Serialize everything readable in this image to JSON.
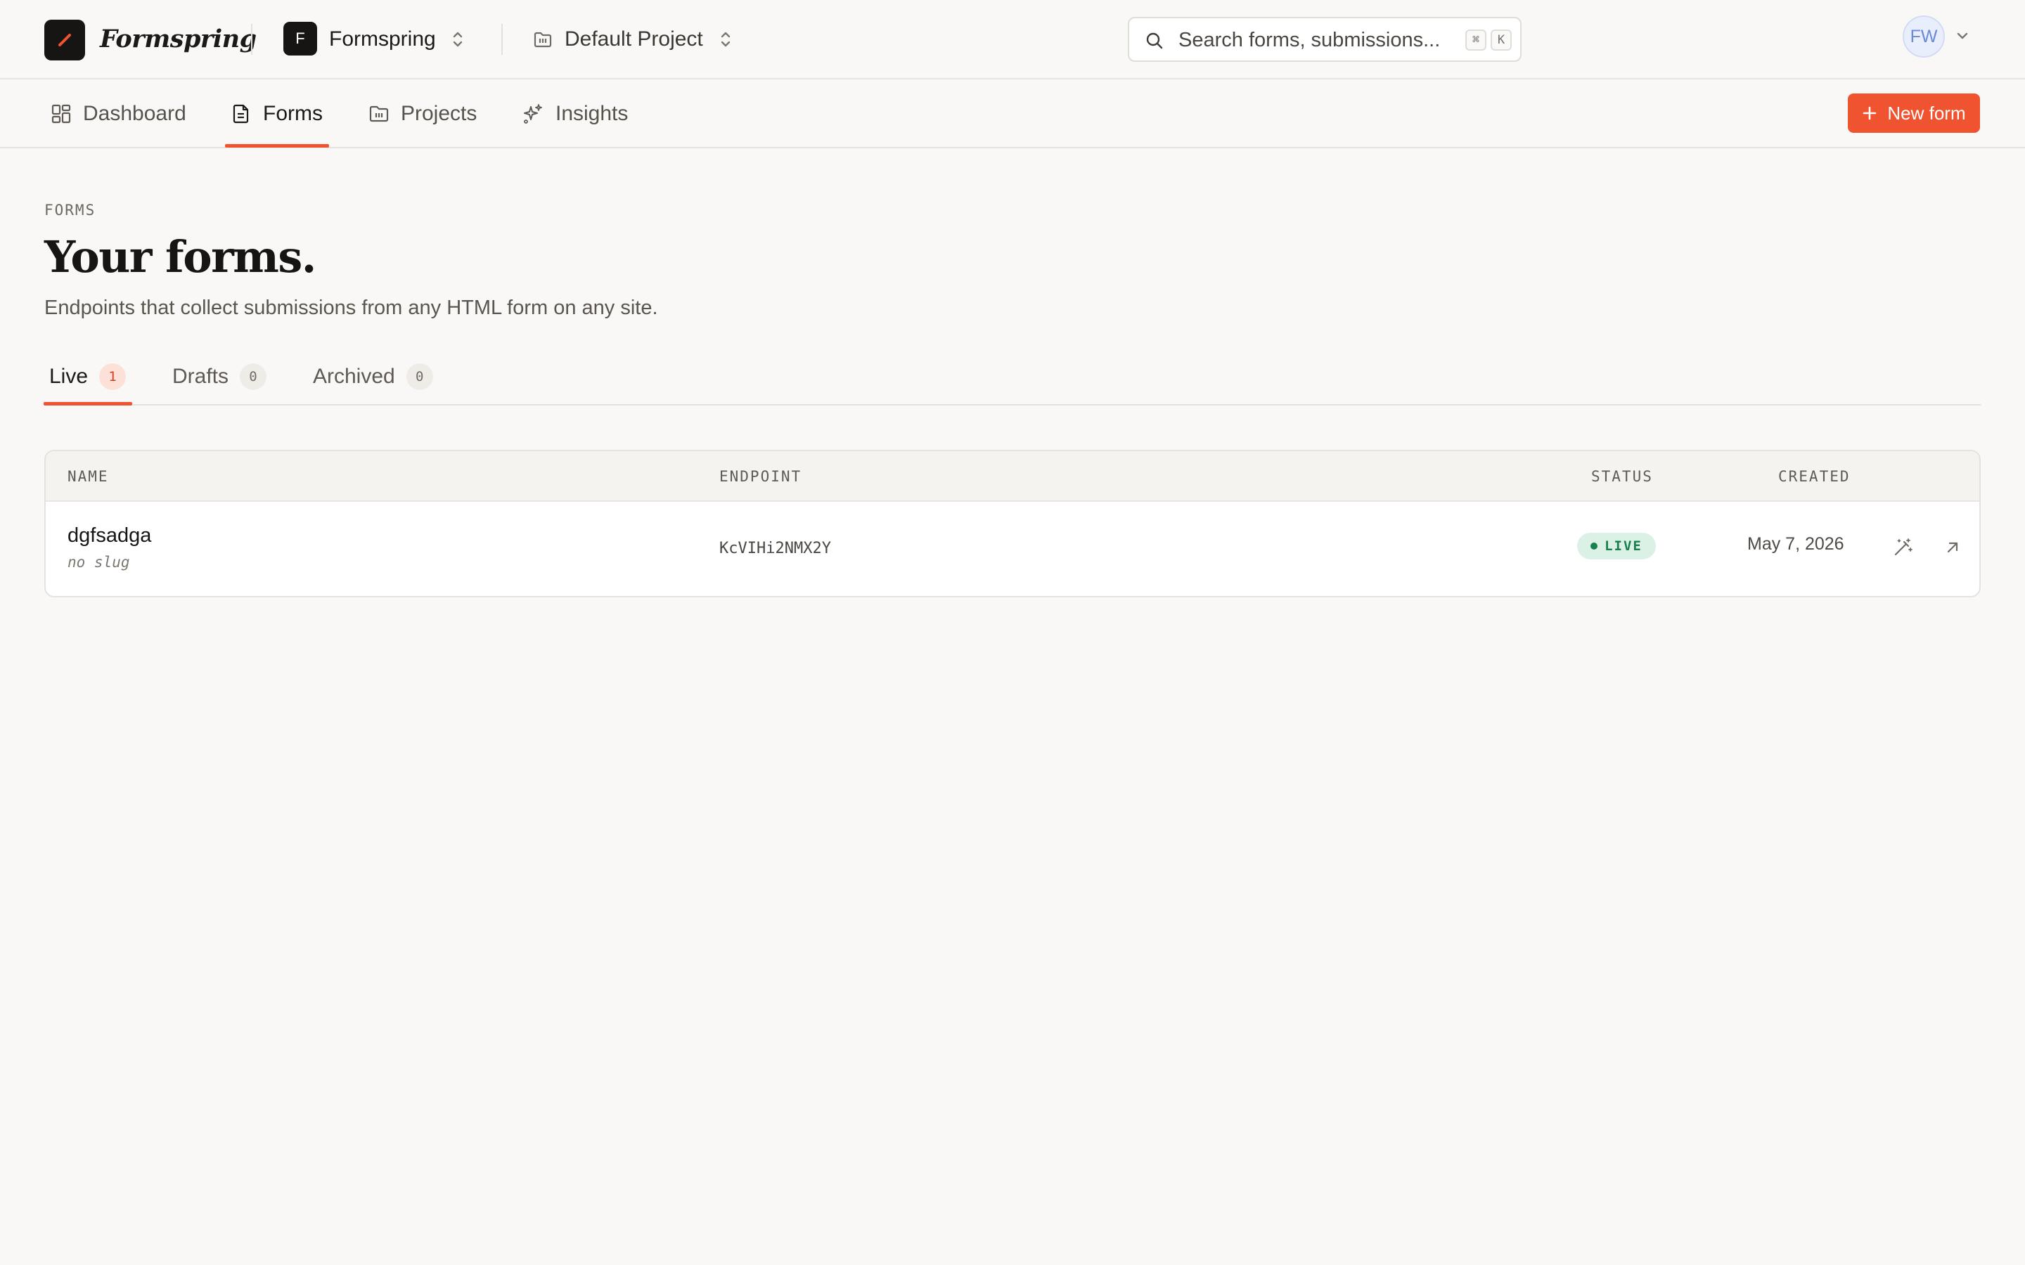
{
  "app": {
    "brand": "Formspring",
    "org": {
      "initial": "F",
      "name": "Formspring"
    },
    "project": {
      "name": "Default Project"
    },
    "search": {
      "placeholder": "Search forms, submissions...",
      "shortcut_mod": "⌘",
      "shortcut_key": "K"
    },
    "user": {
      "initials": "FW"
    }
  },
  "nav": {
    "items": [
      {
        "label": "Dashboard",
        "icon": "dashboard-grid-icon"
      },
      {
        "label": "Forms",
        "icon": "document-icon",
        "active": true
      },
      {
        "label": "Projects",
        "icon": "folder-icon"
      },
      {
        "label": "Insights",
        "icon": "sparkles-icon"
      }
    ],
    "new_form_label": "New form"
  },
  "header": {
    "eyebrow": "FORMS",
    "title": "Your forms.",
    "subtitle": "Endpoints that collect submissions from any HTML form on any site."
  },
  "tabs": [
    {
      "label": "Live",
      "count": "1",
      "active": true
    },
    {
      "label": "Drafts",
      "count": "0"
    },
    {
      "label": "Archived",
      "count": "0"
    }
  ],
  "table": {
    "columns": {
      "name": "NAME",
      "endpoint": "ENDPOINT",
      "status": "STATUS",
      "created": "CREATED"
    },
    "rows": [
      {
        "name": "dgfsadga",
        "slug": "no slug",
        "endpoint": "KcVIHi2NMX2Y",
        "status": "LIVE",
        "created": "May 7, 2026"
      }
    ]
  },
  "colors": {
    "accent": "#f0532f",
    "background": "#f9f8f6",
    "live_badge_bg": "#dcf1e5",
    "live_badge_text": "#17814d"
  }
}
